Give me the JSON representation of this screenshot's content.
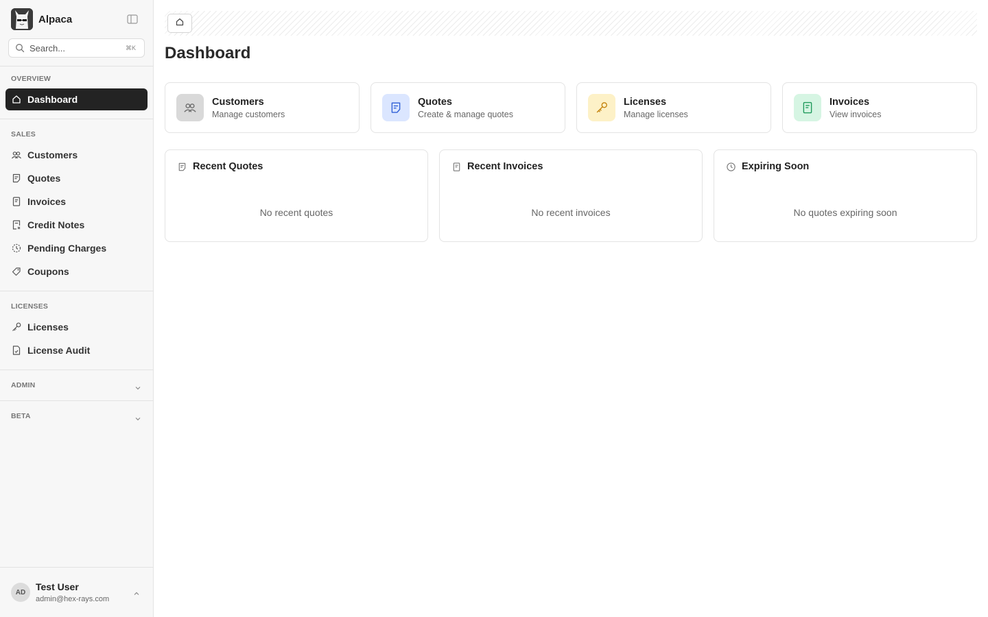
{
  "app": {
    "name": "Alpaca"
  },
  "search": {
    "placeholder": "Search...",
    "shortcut": "⌘K"
  },
  "sidebar": {
    "overview_label": "OVERVIEW",
    "dashboard_label": "Dashboard",
    "sales_label": "SALES",
    "sales_items": [
      {
        "label": "Customers",
        "icon": "users-icon"
      },
      {
        "label": "Quotes",
        "icon": "quote-doc-icon"
      },
      {
        "label": "Invoices",
        "icon": "receipt-icon"
      },
      {
        "label": "Credit Notes",
        "icon": "credit-note-icon"
      },
      {
        "label": "Pending Charges",
        "icon": "clock-dashed-icon"
      },
      {
        "label": "Coupons",
        "icon": "tag-icon"
      }
    ],
    "licenses_label": "LICENSES",
    "license_items": [
      {
        "label": "Licenses",
        "icon": "key-icon"
      },
      {
        "label": "License Audit",
        "icon": "file-audit-icon"
      }
    ],
    "admin_label": "ADMIN",
    "beta_label": "BETA"
  },
  "user": {
    "initials": "AD",
    "name": "Test User",
    "email": "admin@hex-rays.com"
  },
  "page": {
    "title": "Dashboard"
  },
  "quick_cards": [
    {
      "title": "Customers",
      "subtitle": "Manage customers",
      "icon": "users-icon",
      "color": "#6b6b6b",
      "bg": "#d9d9d9"
    },
    {
      "title": "Quotes",
      "subtitle": "Create & manage quotes",
      "icon": "quote-doc-icon",
      "color": "#2f5fd6",
      "bg": "#dbe6ff"
    },
    {
      "title": "Licenses",
      "subtitle": "Manage licenses",
      "icon": "key-icon",
      "color": "#c4820c",
      "bg": "#fdf1c7"
    },
    {
      "title": "Invoices",
      "subtitle": "View invoices",
      "icon": "receipt-icon",
      "color": "#1f9a5b",
      "bg": "#d6f5e3"
    }
  ],
  "panels": [
    {
      "title": "Recent Quotes",
      "empty": "No recent quotes",
      "icon": "quote-doc-icon"
    },
    {
      "title": "Recent Invoices",
      "empty": "No recent invoices",
      "icon": "receipt-icon"
    },
    {
      "title": "Expiring Soon",
      "empty": "No quotes expiring soon",
      "icon": "clock-icon"
    }
  ]
}
